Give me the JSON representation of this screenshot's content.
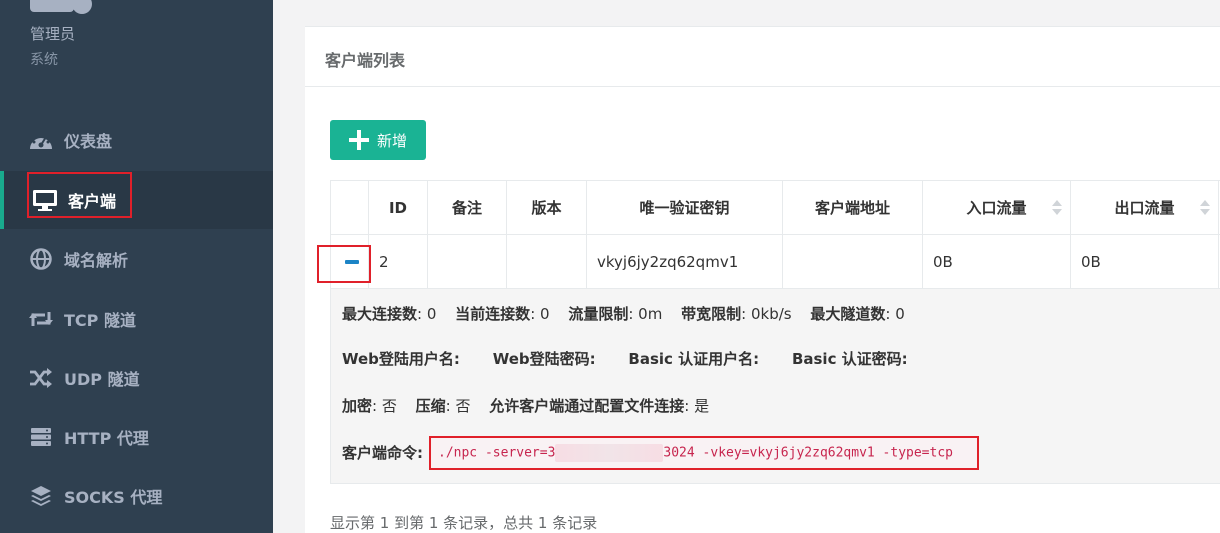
{
  "profile": {
    "name": "管理员",
    "role": "系统"
  },
  "sidebar": {
    "items": [
      {
        "label": "仪表盘",
        "icon": "dashboard-icon"
      },
      {
        "label": "客户端",
        "icon": "desktop-icon"
      },
      {
        "label": "域名解析",
        "icon": "globe-icon"
      },
      {
        "label": "TCP 隧道",
        "icon": "retweet-icon"
      },
      {
        "label": "UDP 隧道",
        "icon": "random-icon"
      },
      {
        "label": "HTTP 代理",
        "icon": "server-icon"
      },
      {
        "label": "SOCKS 代理",
        "icon": "layers-icon"
      }
    ]
  },
  "panel": {
    "title": "客户端列表",
    "add_label": "新增"
  },
  "table": {
    "headers": [
      "ID",
      "备注",
      "版本",
      "唯一验证密钥",
      "客户端地址",
      "入口流量",
      "出口流量"
    ],
    "row": {
      "id": "2",
      "remark": "",
      "version": "",
      "vkey": "vkyj6jy2zq62qmv1",
      "address": "",
      "in_flow": "0B",
      "out_flow": "0B"
    }
  },
  "detail": {
    "max_conn_label": "最大连接数",
    "max_conn": ": 0",
    "cur_conn_label": "当前连接数",
    "cur_conn": ": 0",
    "flow_limit_label": "流量限制",
    "flow_limit": ": 0m",
    "rate_limit_label": "带宽限制",
    "rate_limit": ": 0kb/s",
    "max_tunnel_label": "最大隧道数",
    "max_tunnel": ": 0",
    "web_user_label": "Web登陆用户名:",
    "web_pass_label": "Web登陆密码:",
    "basic_user_label": "Basic 认证用户名:",
    "basic_pass_label": "Basic 认证密码:",
    "encrypt_label": "加密",
    "encrypt": ": 否",
    "compress_label": "压缩",
    "compress": ": 否",
    "config_conn_label": "允许客户端通过配置文件连接",
    "config_conn": ": 是",
    "cmd_label": "客户端命令:",
    "cmd_prefix": "./npc -server=3",
    "cmd_suffix": "3024 -vkey=vkyj6jy2zq62qmv1 -type=tcp"
  },
  "footer": {
    "summary": "显示第 1 到第 1 条记录，总共 1 条记录"
  },
  "colors": {
    "sidebar_bg": "#2f4050",
    "accent": "#1ab394",
    "highlight": "#e0202a"
  }
}
